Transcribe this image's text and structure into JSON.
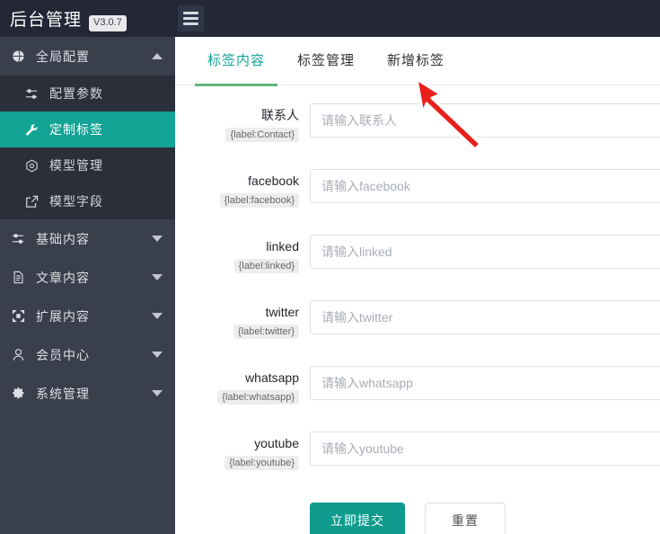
{
  "topbar": {
    "brand_title": "后台管理",
    "version": "V3.0.7",
    "menu_toggle_name": "hamburger-menu"
  },
  "sidebar": {
    "groups": [
      {
        "label": "全局配置",
        "icon": "globe-icon",
        "expanded": true,
        "caret": "up",
        "items": [
          {
            "label": "配置参数",
            "icon": "sliders-icon",
            "active": false
          },
          {
            "label": "定制标签",
            "icon": "wrench-icon",
            "active": true
          },
          {
            "label": "模型管理",
            "icon": "cube-icon",
            "active": false
          },
          {
            "label": "模型字段",
            "icon": "external-link-icon",
            "active": false
          }
        ]
      },
      {
        "label": "基础内容",
        "icon": "sliders-icon",
        "expanded": false,
        "caret": "down",
        "items": []
      },
      {
        "label": "文章内容",
        "icon": "document-icon",
        "expanded": false,
        "caret": "down",
        "items": []
      },
      {
        "label": "扩展内容",
        "icon": "expand-icon",
        "expanded": false,
        "caret": "down",
        "items": []
      },
      {
        "label": "会员中心",
        "icon": "user-icon",
        "expanded": false,
        "caret": "down",
        "items": []
      },
      {
        "label": "系统管理",
        "icon": "gear-icon",
        "expanded": false,
        "caret": "down",
        "items": []
      }
    ]
  },
  "main": {
    "tabs": [
      {
        "label": "标签内容",
        "active": true
      },
      {
        "label": "标签管理",
        "active": false
      },
      {
        "label": "新增标签",
        "active": false
      }
    ],
    "form": {
      "rows": [
        {
          "label": "联系人",
          "tag": "{label:Contact}",
          "placeholder": "请输入联系人",
          "value": ""
        },
        {
          "label": "facebook",
          "tag": "{label:facebook}",
          "placeholder": "请输入facebook",
          "value": ""
        },
        {
          "label": "linked",
          "tag": "{label:linked}",
          "placeholder": "请输入linked",
          "value": ""
        },
        {
          "label": "twitter",
          "tag": "{label:twitter}",
          "placeholder": "请输入twitter",
          "value": ""
        },
        {
          "label": "whatsapp",
          "tag": "{label:whatsapp}",
          "placeholder": "请输入whatsapp",
          "value": ""
        },
        {
          "label": "youtube",
          "tag": "{label:youtube}",
          "placeholder": "请输入youtube",
          "value": ""
        }
      ],
      "submit_label": "立即提交",
      "reset_label": "重置"
    }
  },
  "annotation": {
    "cursor": "red-arrow-pointer"
  },
  "colors": {
    "accent_teal": "#12a395",
    "tab_underline_green": "#5cb87a",
    "topbar_dark": "#232736",
    "sidebar_dark": "#3a3f4c",
    "submenu_dark": "#2b2f3a",
    "submit_button": "#0f9b8e",
    "annotation_red": "#e8201b"
  }
}
